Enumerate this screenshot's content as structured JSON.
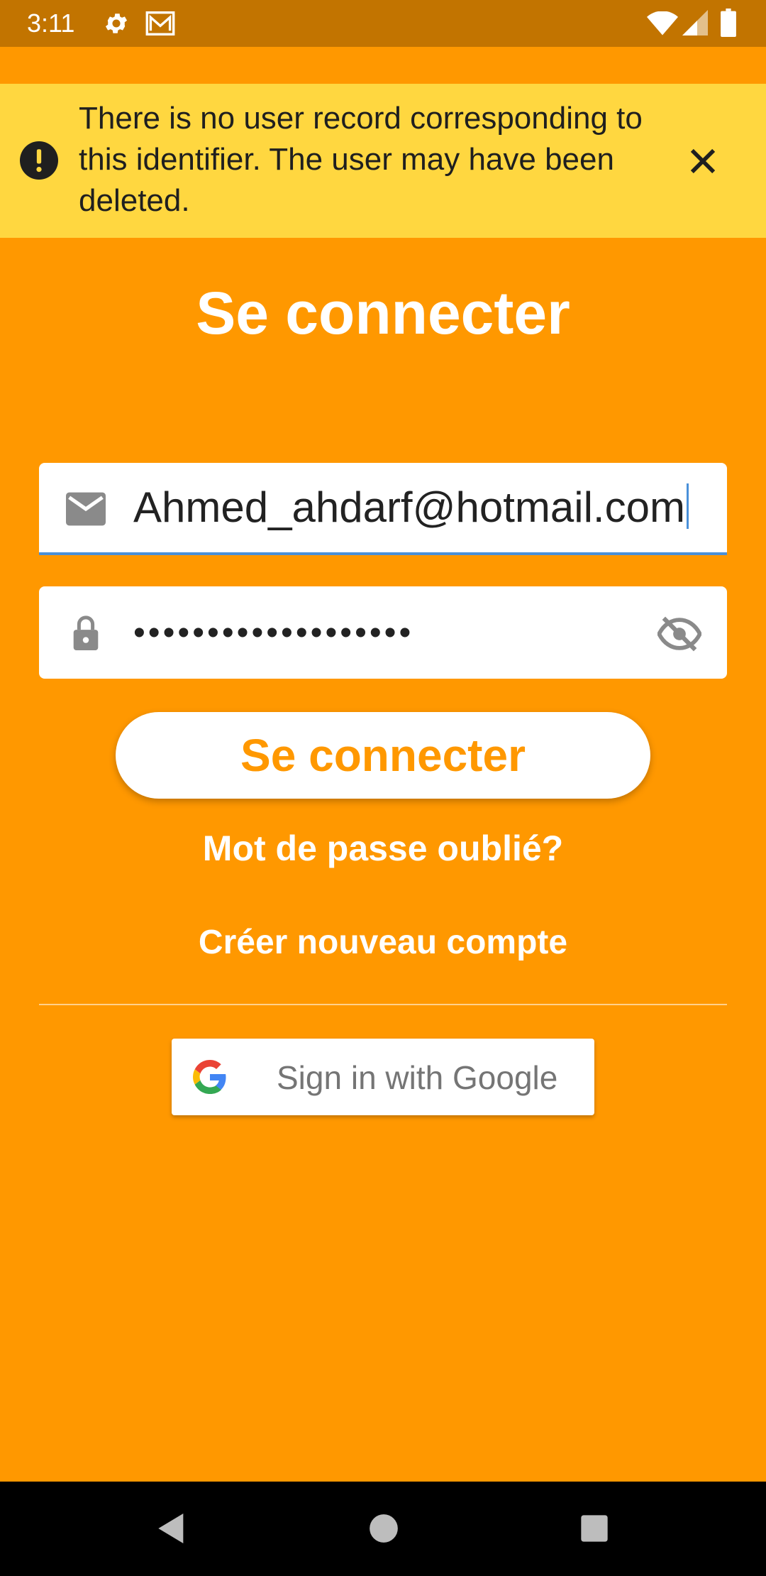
{
  "status_bar": {
    "time": "3:11",
    "icons": [
      "gear-icon",
      "mail-icon",
      "wifi-icon",
      "signal-icon",
      "battery-icon"
    ]
  },
  "banner": {
    "message": "There is no user record corresponding to this identifier. The user may have been deleted.",
    "icon": "alert-icon",
    "close_icon": "close-icon",
    "color": "#FFD740"
  },
  "login": {
    "title": "Se connecter",
    "email_value": "Ahmed_ahdarf@hotmail.com",
    "password_value": "•••••••••••••••••••",
    "submit_label": "Se connecter",
    "forgot_label": "Mot de passe oublié?",
    "create_label": "Créer nouveau compte"
  },
  "google": {
    "label": "Sign in with Google"
  },
  "colors": {
    "background": "#FF9800",
    "status_bar": "#C27400",
    "focus": "#4A90D9"
  }
}
